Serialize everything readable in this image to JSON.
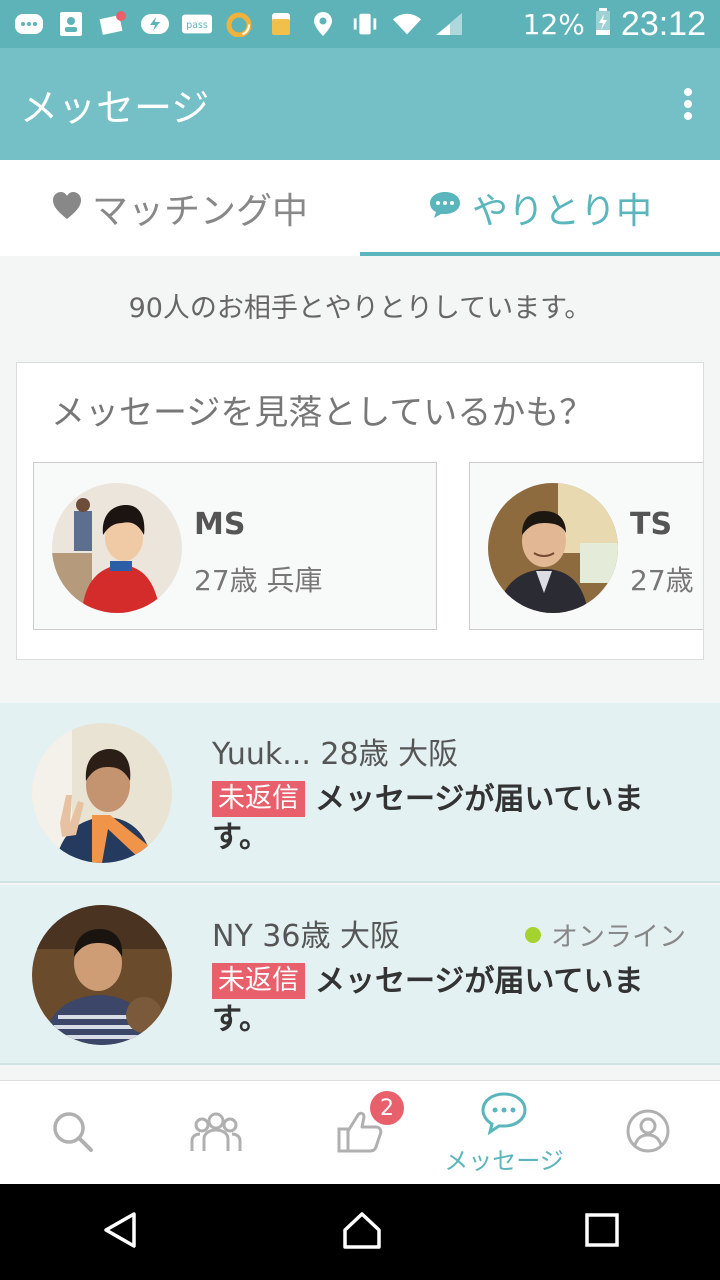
{
  "status_bar": {
    "battery_percent": "12%",
    "time": "23:12",
    "icons": [
      "message-icon",
      "contact-icon",
      "notification-icon",
      "charge-icon",
      "pass-icon",
      "ring-icon",
      "beer-icon",
      "location-icon",
      "vibrate-icon",
      "wifi-icon",
      "signal-icon",
      "battery-icon"
    ]
  },
  "app_bar": {
    "title": "メッセージ"
  },
  "tabs": [
    {
      "label": "マッチング中",
      "icon": "heart-icon"
    },
    {
      "label": "やりとり中",
      "icon": "chat-bubble-icon"
    }
  ],
  "summary_text": "90人のお相手とやりとりしています。",
  "missed": {
    "title": "メッセージを見落としているかも？",
    "cards": [
      {
        "name": "MS",
        "info": "27歳 兵庫"
      },
      {
        "name": "TS",
        "info": "27歳"
      }
    ]
  },
  "conversations": [
    {
      "header": "Yuuk... 28歳 大阪",
      "badge": "未返信",
      "message": "メッセージが届いています。",
      "online": ""
    },
    {
      "header": "NY 36歳 大阪",
      "badge": "未返信",
      "message": "メッセージが届いています。",
      "online": "オンライン"
    }
  ],
  "bottom_nav": {
    "items": [
      {
        "icon": "search-icon",
        "label": ""
      },
      {
        "icon": "people-icon",
        "label": ""
      },
      {
        "icon": "thumbs-up-icon",
        "label": "",
        "badge": "2"
      },
      {
        "icon": "chat-bubble-icon",
        "label": "メッセージ"
      },
      {
        "icon": "profile-icon",
        "label": ""
      }
    ]
  },
  "colors": {
    "status_bar": "#5db3b8",
    "app_bar": "#74c0c6",
    "accent": "#5bb5bc",
    "row_background": "#e4f1f3",
    "badge_red": "#e8606c",
    "online_green": "#a4d22e"
  }
}
